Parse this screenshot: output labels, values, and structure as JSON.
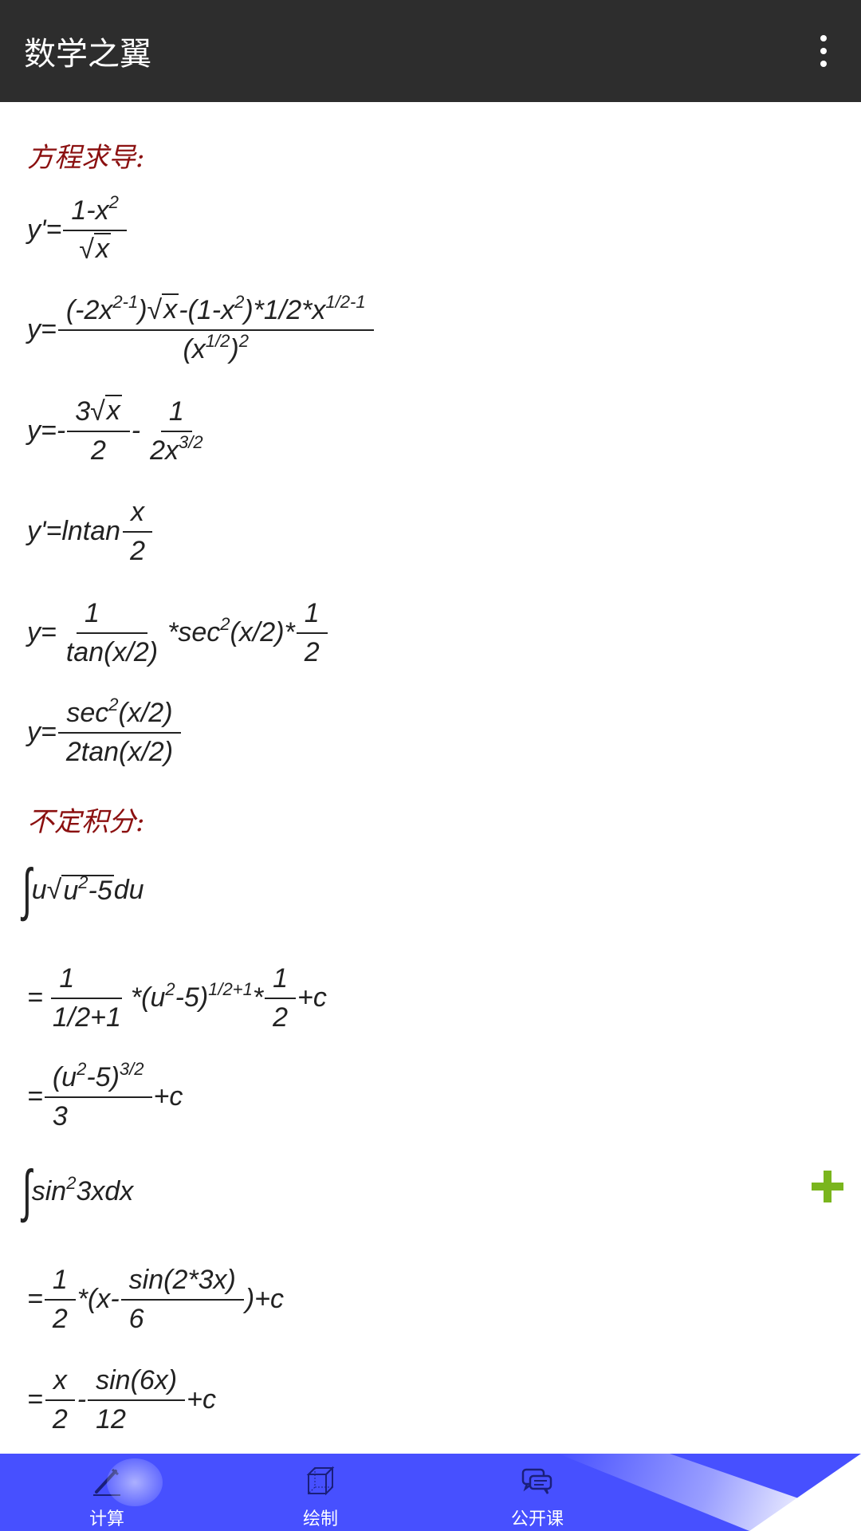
{
  "app": {
    "title": "数学之翼"
  },
  "sections": {
    "derivative": "方程求导:",
    "integral": "不定积分:"
  },
  "nav": {
    "calc": "计算",
    "draw": "绘制",
    "course": "公开课"
  },
  "colors": {
    "appbar": "#2d2d2d",
    "section_title": "#8b1010",
    "bottom_nav": "#4750ff",
    "fab": "#7ab51d"
  },
  "icons": {
    "menu": "more-vert-icon",
    "fab": "plus-icon",
    "calc": "pencil-icon",
    "draw": "cube-icon",
    "course": "chat-bubbles-icon"
  }
}
